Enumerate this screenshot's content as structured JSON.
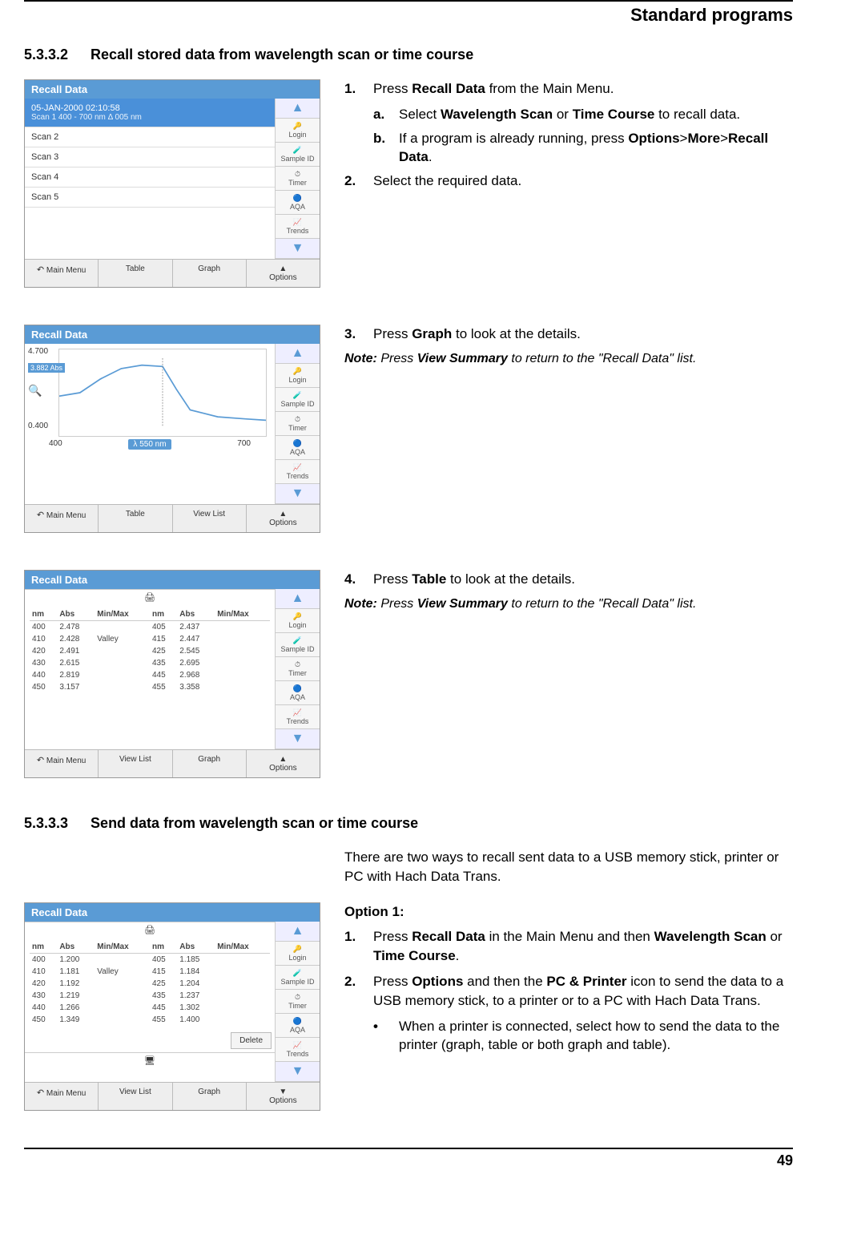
{
  "page": {
    "header": "Standard programs",
    "number": "49"
  },
  "sections": [
    {
      "num": "5.3.3.2",
      "title": "Recall stored data from wavelength scan or time course"
    },
    {
      "num": "5.3.3.3",
      "title": "Send data from wavelength scan or time course"
    }
  ],
  "steps": {
    "s1": {
      "num": "1.",
      "text_pre": "Press ",
      "text_bold": "Recall Data",
      "text_post": " from the Main Menu.",
      "a": {
        "label": "a.",
        "pre": "Select ",
        "b1": "Wavelength Scan",
        "mid": " or ",
        "b2": "Time Course",
        "post": " to recall data."
      },
      "b": {
        "label": "b.",
        "pre": "If a program is already running, press ",
        "b1": "Options",
        "gt1": ">",
        "b2": "More",
        "gt2": ">",
        "b3": "Recall Data",
        "post": "."
      }
    },
    "s2": {
      "num": "2.",
      "text": "Select the required data."
    },
    "s3": {
      "num": "3.",
      "pre": "Press ",
      "b": "Graph",
      "post": " to look at the details.",
      "note_pre": "Note:",
      "note_mid": " Press ",
      "note_b": "View Summary",
      "note_post": " to return to the \"Recall Data\" list."
    },
    "s4": {
      "num": "4.",
      "pre": "Press ",
      "b": "Table",
      "post": " to look at the details.",
      "note_pre": "Note:",
      "note_mid": " Press ",
      "note_b": "View Summary",
      "note_post": " to return to the \"Recall Data\" list."
    }
  },
  "send": {
    "intro": "There are two ways to recall sent data to a USB memory stick, printer or PC with Hach Data Trans.",
    "opt1_heading": "Option 1:",
    "s1": {
      "num": "1.",
      "pre": "Press ",
      "b1": "Recall Data",
      "mid": " in the Main Menu and then ",
      "b2": "Wavelength Scan",
      "mid2": " or ",
      "b3": "Time Course",
      "post": "."
    },
    "s2": {
      "num": "2.",
      "pre": "Press ",
      "b1": "Options",
      "mid": " and then the ",
      "b2": "PC & Printer",
      "post": " icon to send the data to a USB memory stick, to a printer or to a PC with Hach Data Trans."
    },
    "bullet": {
      "dot": "•",
      "text": "When a printer is connected, select how to send the data to the printer (graph, table or both graph and table)."
    }
  },
  "ss_common": {
    "title": "Recall Data",
    "side": {
      "login": "Login",
      "sample": "Sample ID",
      "timer": "Timer",
      "aqa": "AQA",
      "trends": "Trends"
    },
    "footer": {
      "main": "Main Menu",
      "table": "Table",
      "graph": "Graph",
      "options": "Options",
      "viewlist": "View List"
    }
  },
  "ss1": {
    "sel_date": "05-JAN-2000  02:10:58",
    "sel_info": "Scan 1   400 - 700 nm Δ 005 nm",
    "rows": [
      "Scan 2",
      "Scan 3",
      "Scan 4",
      "Scan 5"
    ]
  },
  "ss2": {
    "ymax": "4.700",
    "ymin": "0.400",
    "abs_badge": "3.882 Abs",
    "xmin": "400",
    "xmid": "λ 550 nm",
    "xmax": "700"
  },
  "ss3": {
    "headers": [
      "nm",
      "Abs",
      "Min/Max",
      "nm",
      "Abs",
      "Min/Max"
    ],
    "rows": [
      [
        "400",
        "2.478",
        "",
        "405",
        "2.437",
        ""
      ],
      [
        "410",
        "2.428",
        "Valley",
        "415",
        "2.447",
        ""
      ],
      [
        "420",
        "2.491",
        "",
        "425",
        "2.545",
        ""
      ],
      [
        "430",
        "2.615",
        "",
        "435",
        "2.695",
        ""
      ],
      [
        "440",
        "2.819",
        "",
        "445",
        "2.968",
        ""
      ],
      [
        "450",
        "3.157",
        "",
        "455",
        "3.358",
        ""
      ]
    ]
  },
  "ss4": {
    "headers": [
      "nm",
      "Abs",
      "Min/Max",
      "nm",
      "Abs",
      "Min/Max"
    ],
    "rows": [
      [
        "400",
        "1.200",
        "",
        "405",
        "1.185",
        ""
      ],
      [
        "410",
        "1.181",
        "Valley",
        "415",
        "1.184",
        ""
      ],
      [
        "420",
        "1.192",
        "",
        "425",
        "1.204",
        ""
      ],
      [
        "430",
        "1.219",
        "",
        "435",
        "1.237",
        ""
      ],
      [
        "440",
        "1.266",
        "",
        "445",
        "1.302",
        ""
      ],
      [
        "450",
        "1.349",
        "",
        "455",
        "1.400",
        ""
      ]
    ],
    "delete": "Delete"
  }
}
